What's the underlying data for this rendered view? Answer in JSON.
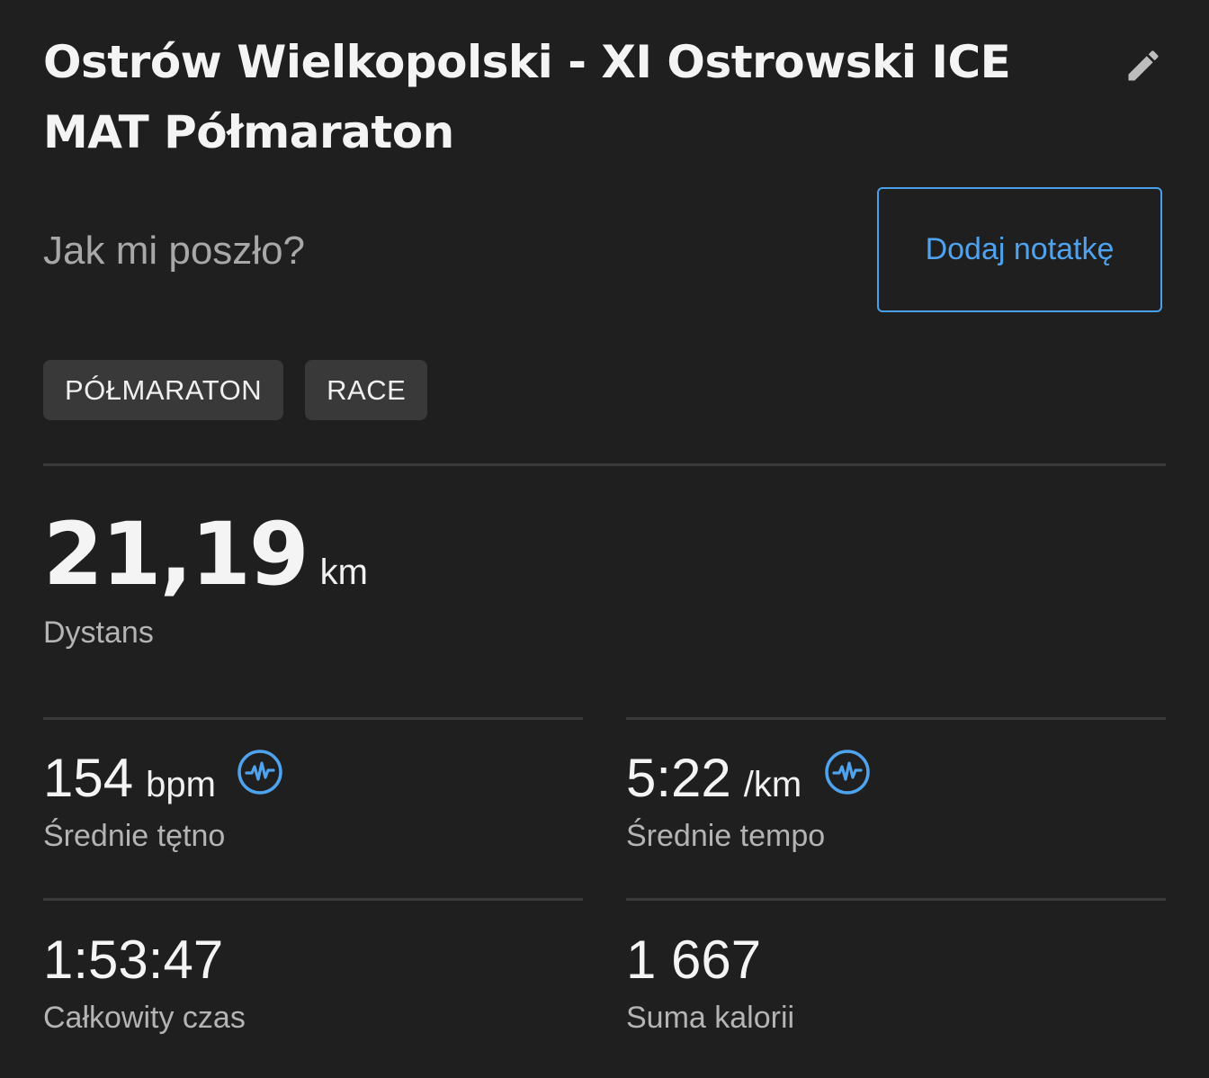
{
  "activity": {
    "title": "Ostrów Wielkopolski - XI Ostrowski ICE MAT Półmaraton",
    "edit_icon": "pencil-icon"
  },
  "feedback": {
    "question": "Jak mi poszło?",
    "add_note_label": "Dodaj notatkę"
  },
  "tags": [
    "PÓŁMARATON",
    "RACE"
  ],
  "distance": {
    "value": "21,19",
    "unit": "km",
    "label": "Dystans"
  },
  "stats": {
    "heart_rate": {
      "value": "154",
      "unit": "bpm",
      "label": "Średnie tętno",
      "icon": "heart-rate-chart-icon"
    },
    "pace": {
      "value": "5:22",
      "unit": "/km",
      "label": "Średnie tempo",
      "icon": "pace-chart-icon"
    },
    "total_time": {
      "value": "1:53:47",
      "label": "Całkowity czas"
    },
    "calories": {
      "value": "1 667",
      "label": "Suma kalorii"
    }
  },
  "colors": {
    "background": "#1f1f1f",
    "accent": "#4fa3ee",
    "tag_bg": "#393939",
    "divider": "#3a3a3a"
  }
}
